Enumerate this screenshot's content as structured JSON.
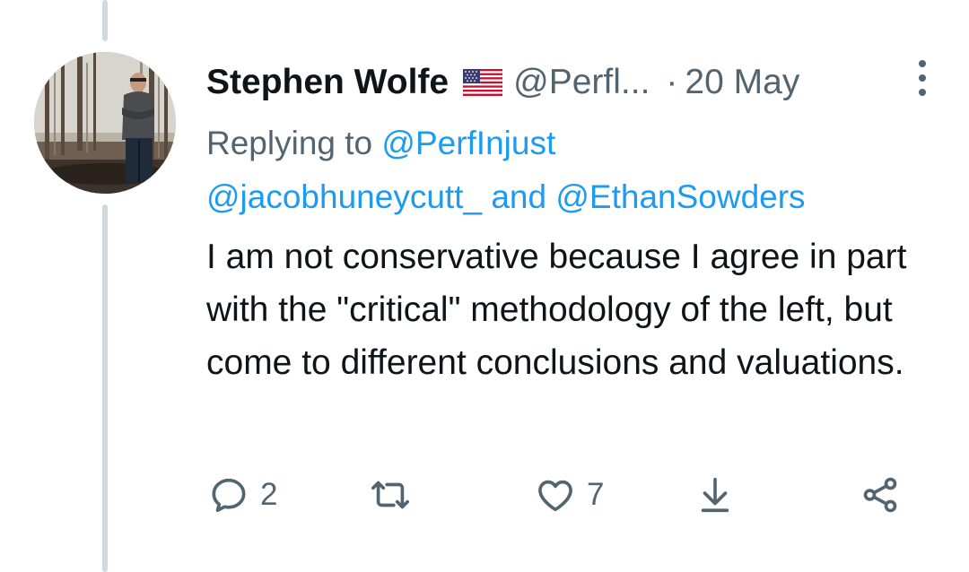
{
  "tweet": {
    "author_name": "Stephen Wolfe",
    "flag_icon": "us-flag-icon",
    "handle": "@Perfl...",
    "separator": "·",
    "timestamp": "20 May",
    "replying_prefix": "Replying to",
    "replying_mention_1": "@PerfInjust",
    "replying_mention_2": "@jacobhuneycutt_",
    "replying_and": "and",
    "replying_mention_3": "@EthanSowders",
    "text": "I am not conservative because I agree in part with the \"critical\" methodology of the left, but come to different conclusions and valuations."
  },
  "actions": {
    "reply_icon": "reply-icon",
    "reply_count": "2",
    "retweet_icon": "retweet-icon",
    "like_icon": "heart-icon",
    "like_count": "7",
    "download_icon": "download-icon",
    "share_icon": "share-icon"
  },
  "colors": {
    "text": "#0f1419",
    "secondary": "#536471",
    "link": "#1d9bf0",
    "thread_line": "#cfd9de"
  }
}
